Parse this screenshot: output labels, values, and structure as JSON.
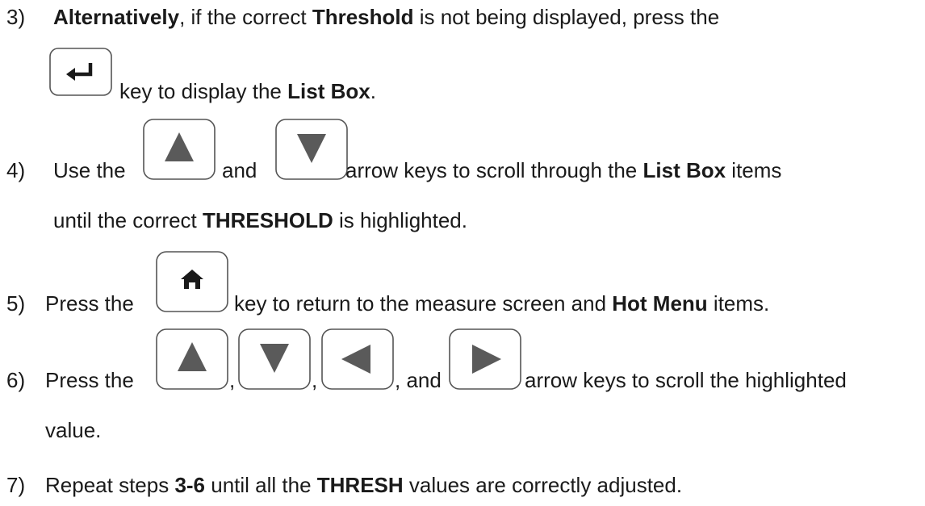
{
  "steps": [
    {
      "number": "3)",
      "line1": {
        "b1": "Alternatively",
        "t1": ", if the correct ",
        "b2": "Threshold",
        "t2": " is not being displayed, press the"
      },
      "line2": {
        "t1": "key to display the ",
        "b1": "List Box",
        "t2": "."
      },
      "keys": [
        "enter-key"
      ]
    },
    {
      "number": "4)",
      "line1": {
        "t1": "Use the",
        "t2": "and",
        "t3": "arrow keys to scroll through the ",
        "b1": "List Box",
        "t4": " items"
      },
      "line2": {
        "t1": "until the correct ",
        "b1": "THRESHOLD",
        "t2": " is highlighted."
      },
      "keys": [
        "up-arrow-key",
        "down-arrow-key"
      ]
    },
    {
      "number": "5)",
      "line1": {
        "t1": "Press the",
        "t2": "key to return to the measure screen and ",
        "b1": "Hot Menu",
        "t3": " items."
      },
      "keys": [
        "home-key"
      ]
    },
    {
      "number": "6)",
      "line1": {
        "t1": "Press the",
        "c1": ",",
        "c2": ",",
        "t2": ", and",
        "t3": "arrow keys to scroll the highlighted"
      },
      "line2": {
        "t1": "value."
      },
      "keys": [
        "up-arrow-key",
        "down-arrow-key",
        "left-arrow-key",
        "right-arrow-key"
      ]
    },
    {
      "number": "7)",
      "line1": {
        "t1": "Repeat steps ",
        "b1": "3-6",
        "t2": " until all the ",
        "b2": "THRESH",
        "t3": " values are correctly adjusted."
      }
    }
  ],
  "colors": {
    "text": "#1a1a1a",
    "key_border": "#555555",
    "key_glyph": "#5a5a5a",
    "enter_glyph": "#1a1a1a"
  }
}
